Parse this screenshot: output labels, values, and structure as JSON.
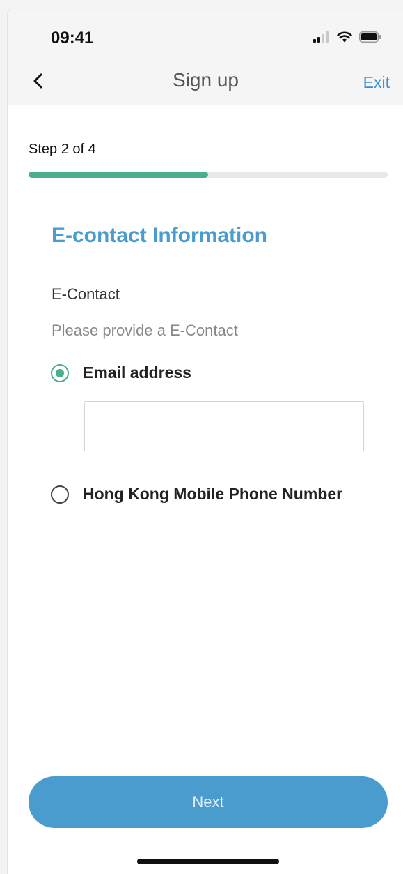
{
  "status_bar": {
    "time": "09:41",
    "signal_icon": "signal-bars-icon",
    "wifi_icon": "wifi-icon",
    "battery_icon": "battery-icon"
  },
  "nav": {
    "back_icon": "chevron-left-icon",
    "title": "Sign up",
    "exit_label": "Exit"
  },
  "progress": {
    "label": "Step 2 of 4",
    "current_step": 2,
    "total_steps": 4,
    "fraction": 0.5
  },
  "form": {
    "section_title": "E-contact Information",
    "field_label": "E-Contact",
    "field_help": "Please provide a E-Contact",
    "options": [
      {
        "label": "Email address",
        "selected": true
      },
      {
        "label": "Hong Kong Mobile Phone Number",
        "selected": false
      }
    ],
    "email_value": ""
  },
  "actions": {
    "next_label": "Next"
  },
  "colors": {
    "accent_blue": "#4a9ccf",
    "exit_blue": "#3d8fd1",
    "progress_green": "#4caf8c",
    "track_gray": "#e8e8e8"
  }
}
